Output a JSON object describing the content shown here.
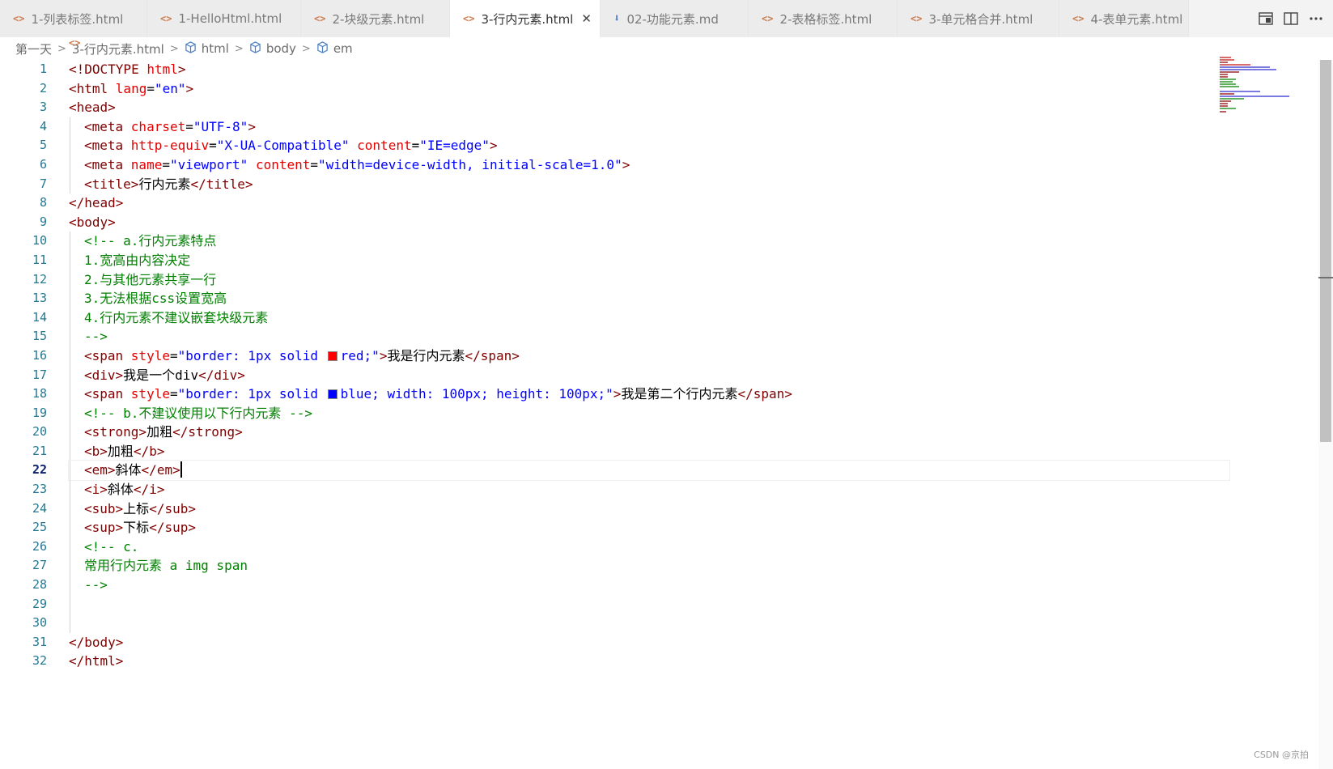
{
  "tabs": [
    {
      "label": "1-列表标签.html",
      "icon": "html-file-icon",
      "active": false
    },
    {
      "label": "1-HelloHtml.html",
      "icon": "html-file-icon",
      "active": false
    },
    {
      "label": "2-块级元素.html",
      "icon": "html-file-icon",
      "active": false
    },
    {
      "label": "3-行内元素.html",
      "icon": "html-file-icon",
      "active": true
    },
    {
      "label": "02-功能元素.md",
      "icon": "markdown-file-icon",
      "active": false
    },
    {
      "label": "2-表格标签.html",
      "icon": "html-file-icon",
      "active": false
    },
    {
      "label": "3-单元格合并.html",
      "icon": "html-file-icon",
      "active": false
    },
    {
      "label": "4-表单元素.html",
      "icon": "html-file-icon",
      "active": false
    }
  ],
  "tab_actions": [
    "open-preview-icon",
    "split-editor-icon",
    "more-actions-icon"
  ],
  "breadcrumb": {
    "folder": "第一天",
    "file": "3-行内元素.html",
    "symbols": [
      "html",
      "body",
      "em"
    ]
  },
  "editor": {
    "current_line": 22,
    "line_numbers": [
      "1",
      "2",
      "3",
      "4",
      "5",
      "6",
      "7",
      "8",
      "9",
      "10",
      "11",
      "12",
      "13",
      "14",
      "15",
      "16",
      "17",
      "18",
      "19",
      "20",
      "21",
      "22",
      "23",
      "24",
      "25",
      "26",
      "27",
      "28",
      "29",
      "30",
      "31",
      "32"
    ],
    "code": {
      "l1": {
        "a": "<!DOCTYPE ",
        "b": "html",
        "c": ">"
      },
      "l2": {
        "a": "<html ",
        "b": "lang",
        "c": "=",
        "d": "\"en\"",
        "e": ">"
      },
      "l3": {
        "a": "<head>"
      },
      "l4": {
        "a": "<meta ",
        "b": "charset",
        "c": "=",
        "d": "\"UTF-8\"",
        "e": ">"
      },
      "l5": {
        "a": "<meta ",
        "b": "http-equiv",
        "c": "=",
        "d": "\"X-UA-Compatible\" ",
        "e": "content",
        "f": "=",
        "g": "\"IE=edge\"",
        "h": ">"
      },
      "l6": {
        "a": "<meta ",
        "b": "name",
        "c": "=",
        "d": "\"viewport\" ",
        "e": "content",
        "f": "=",
        "g": "\"width=device-width, initial-scale=1.0\"",
        "h": ">"
      },
      "l7": {
        "a": "<title>",
        "b": "行内元素",
        "c": "</title>"
      },
      "l8": {
        "a": "</head>"
      },
      "l9": {
        "a": "<body>"
      },
      "l10": {
        "a": "<!-- a.行内元素特点"
      },
      "l11": {
        "a": "1.宽高由内容决定"
      },
      "l12": {
        "a": "2.与其他元素共享一行"
      },
      "l13": {
        "a": "3.无法根据css设置宽高"
      },
      "l14": {
        "a": "4.行内元素不建议嵌套块级元素"
      },
      "l15": {
        "a": "-->"
      },
      "l16": {
        "a": "<span ",
        "b": "style",
        "c": "=",
        "d": "\"border: 1px solid ",
        "e": "red;\"",
        "f": ">",
        "g": "我是行内元素",
        "h": "</span>"
      },
      "l17": {
        "a": "<div>",
        "b": "我是一个div",
        "c": "</div>"
      },
      "l18": {
        "a": "<span ",
        "b": "style",
        "c": "=",
        "d": "\"border: 1px solid ",
        "e": "blue; width: 100px; height: 100px;\"",
        "f": ">",
        "g": "我是第二个行内元素",
        "h": "</span>"
      },
      "l19": {
        "a": "<!-- b.不建议使用以下行内元素 -->"
      },
      "l20": {
        "a": "<strong>",
        "b": "加粗",
        "c": "</strong>"
      },
      "l21": {
        "a": "<b>",
        "b": "加粗",
        "c": "</b>"
      },
      "l22": {
        "a": "<em>",
        "b": "斜体",
        "c": "</em>"
      },
      "l23": {
        "a": "<i>",
        "b": "斜体",
        "c": "</i>"
      },
      "l24": {
        "a": "<sub>",
        "b": "上标",
        "c": "</sub>"
      },
      "l25": {
        "a": "<sup>",
        "b": "下标",
        "c": "</sup>"
      },
      "l26": {
        "a": "<!-- c."
      },
      "l27": {
        "a": "常用行内元素 a img span"
      },
      "l28": {
        "a": "-->"
      },
      "l31": {
        "a": "</body>"
      },
      "l32": {
        "a": "</html>"
      }
    },
    "swatches": {
      "red": "#ff0000",
      "blue": "#0000ff"
    }
  },
  "watermark": "CSDN @京拍",
  "colors": {
    "tag": "#800000",
    "attribute": "#e50000",
    "string": "#0000ff",
    "comment": "#008000",
    "line_number": "#237893"
  }
}
